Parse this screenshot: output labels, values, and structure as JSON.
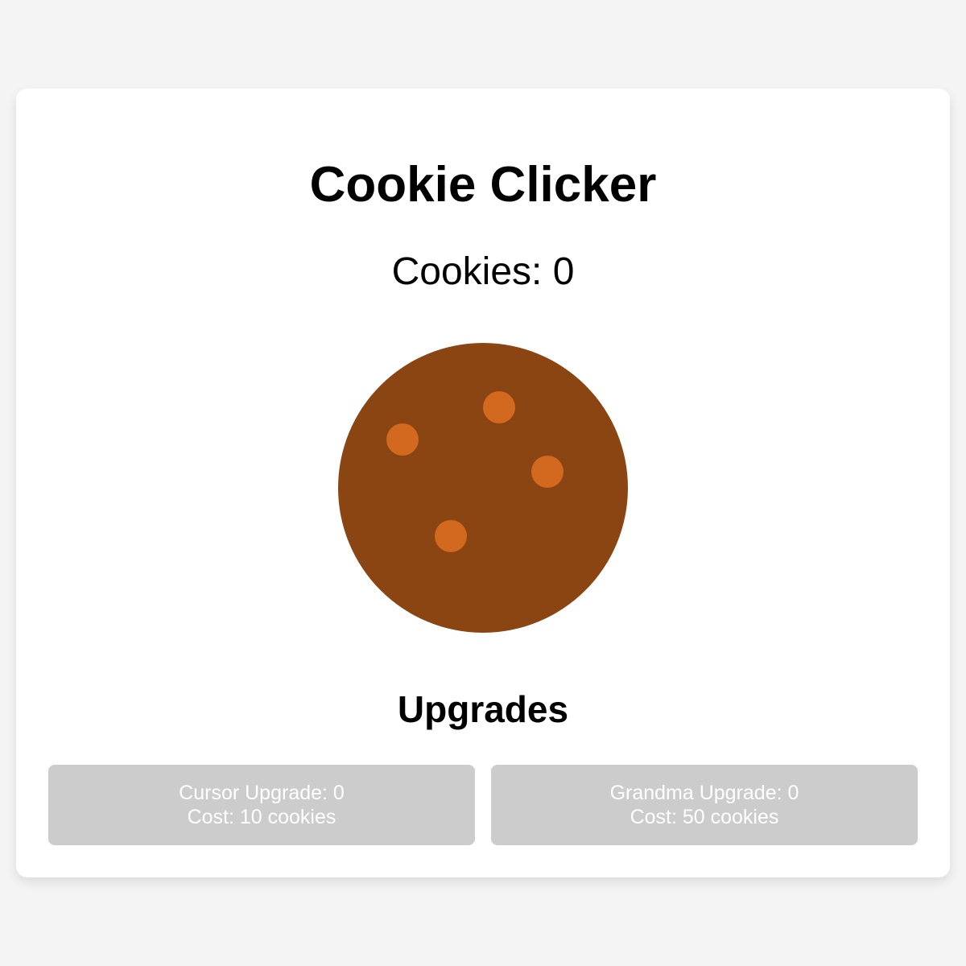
{
  "game": {
    "title": "Cookie Clicker",
    "counter_label": "Cookies: ",
    "cookie_count": "0"
  },
  "upgrades": {
    "heading": "Upgrades",
    "items": [
      {
        "name_label": "Cursor Upgrade: ",
        "level": "0",
        "cost_text": "Cost: 10 cookies"
      },
      {
        "name_label": "Grandma Upgrade: ",
        "level": "0",
        "cost_text": "Cost: 50 cookies"
      }
    ]
  },
  "colors": {
    "cookie": "#8b4513",
    "chip": "#d2691e",
    "disabled_button": "#cccccc",
    "background": "#f4f4f4"
  }
}
